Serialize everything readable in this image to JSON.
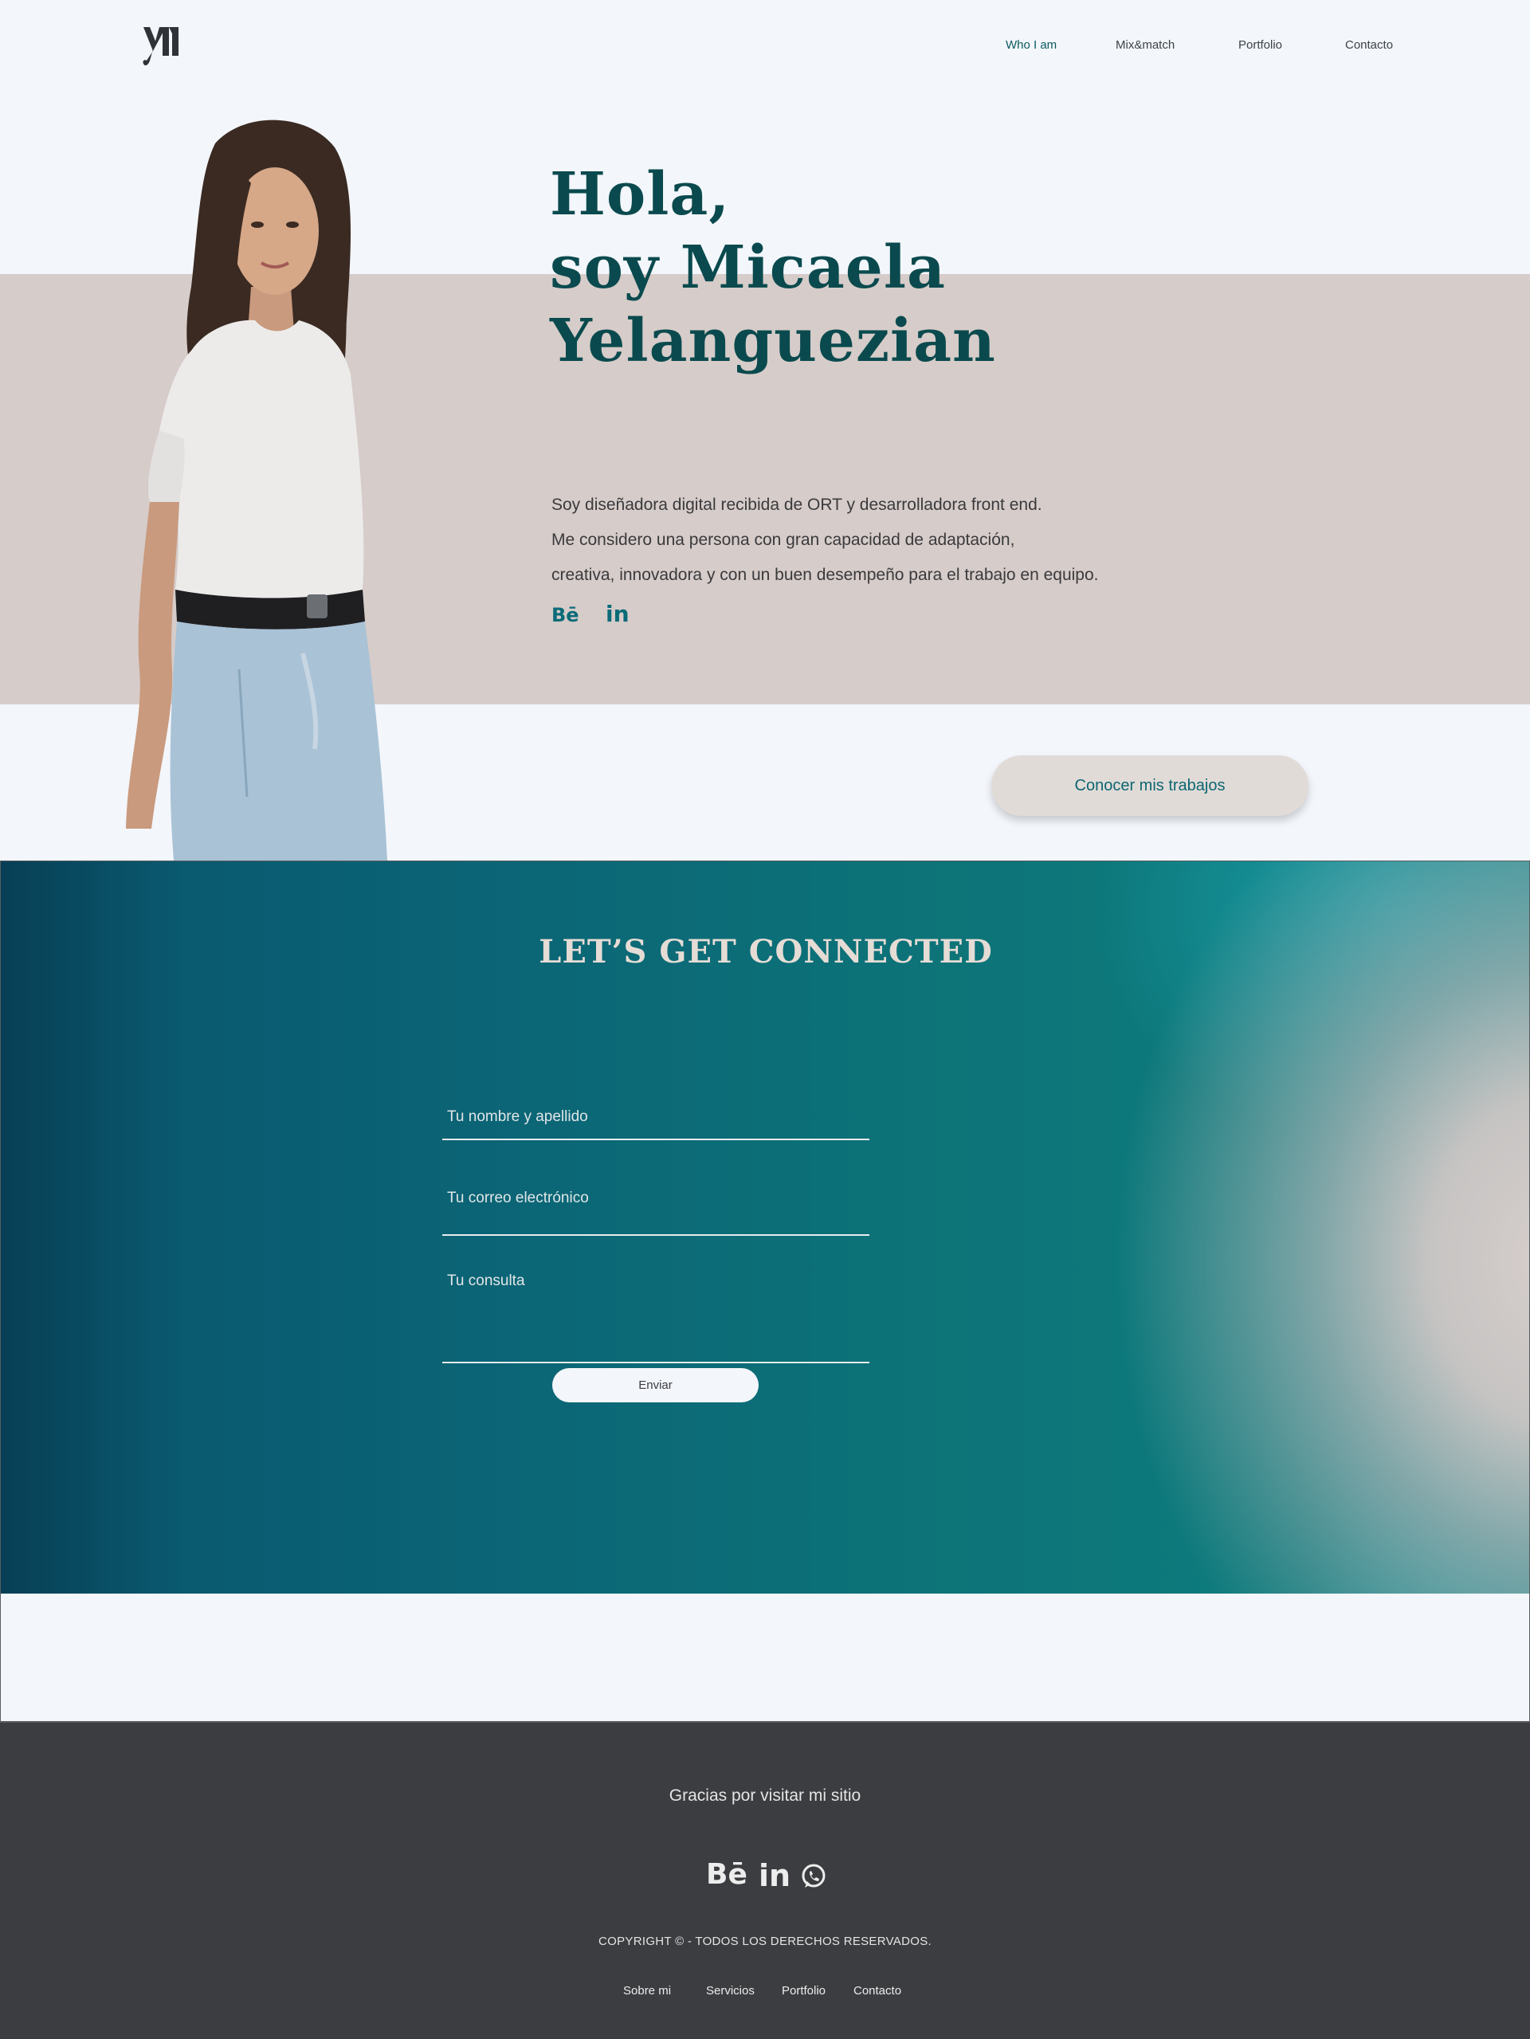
{
  "header": {
    "nav": [
      "Who I am",
      "Mix&match",
      "Portfolio",
      "Contacto"
    ],
    "active_nav": "Who I am"
  },
  "hero": {
    "title_lines": [
      "Hola,",
      "soy Micaela",
      "Yelanguezian"
    ],
    "description_lines": [
      "Soy diseñadora digital recibida de ORT y desarrolladora front end.",
      "Me considero una persona con gran capacidad  de adaptación,",
      "creativa, innovadora  y con un buen desempeño para el trabajo en equipo."
    ],
    "social_icons": [
      "behance-icon",
      "linkedin-icon"
    ],
    "cta_label": "Conocer mis trabajos"
  },
  "contact": {
    "title": "LET’S GET CONNECTED",
    "name_placeholder": "Tu nombre y apellido",
    "email_placeholder": "Tu correo electrónico",
    "message_placeholder": "Tu consulta",
    "submit_label": "Enviar"
  },
  "footer": {
    "thanks": "Gracias por visitar mi sitio",
    "social_icons": [
      "behance-icon",
      "linkedin-icon",
      "whatsapp-icon"
    ],
    "copyright": "COPYRIGHT ©  - TODOS LOS DERECHOS RESERVADOS.",
    "links": [
      "Sobre mi",
      "Servicios",
      "Portfolio",
      "Contacto"
    ]
  },
  "colors": {
    "brand_dark_teal": "#0a4a4e",
    "accent_teal": "#0d6670",
    "hero_band": "#d6ccc9",
    "page_bg": "#f3f6fb",
    "footer_bg": "#3c3d40"
  }
}
